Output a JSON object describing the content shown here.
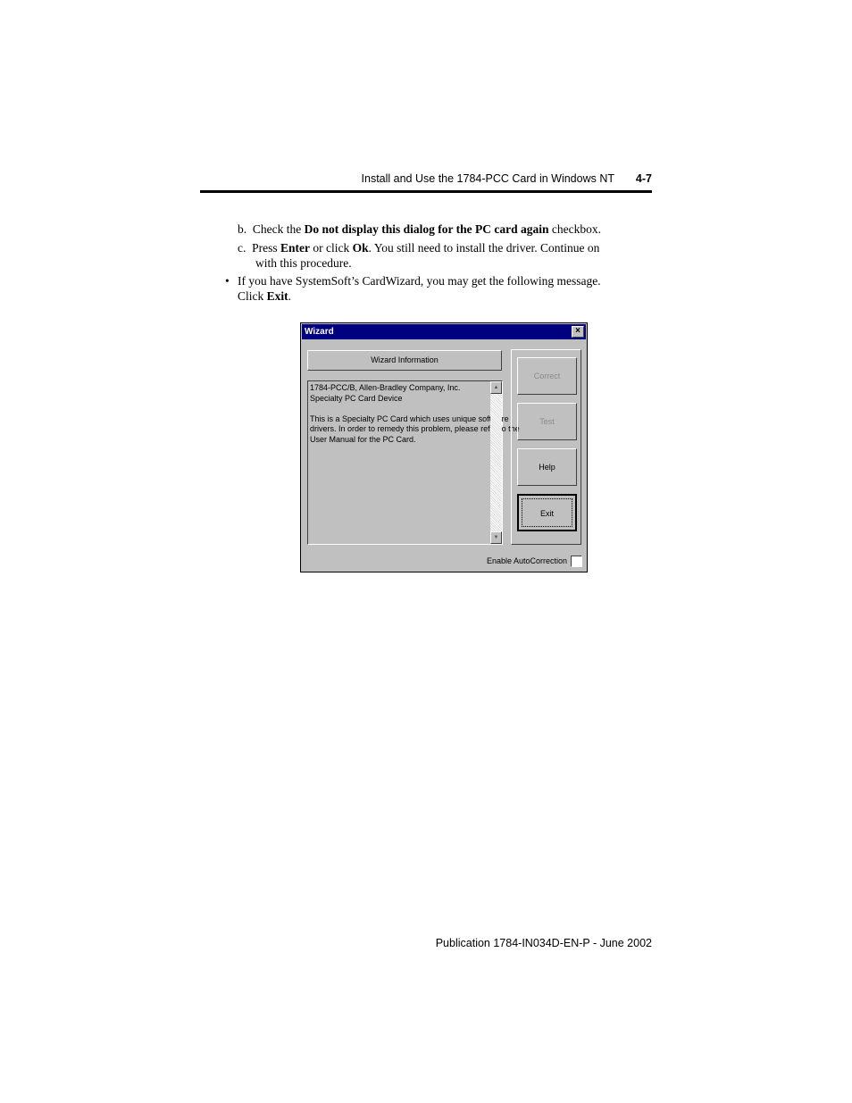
{
  "header": {
    "title": "Install and Use the 1784-PCC Card in Windows NT",
    "page_number": "4-7"
  },
  "steps": {
    "b": {
      "label": "b.",
      "before": "Check the ",
      "bold": "Do not display this dialog for the PC card again",
      "after": " checkbox."
    },
    "c": {
      "label": "c.",
      "t1": "Press ",
      "b1": "Enter",
      "t2": " or click ",
      "b2": "Ok",
      "t3": ". You still need to install the driver. Continue on",
      "line2": "with this procedure."
    }
  },
  "bullet": {
    "symbol": "•",
    "line1": "If you have SystemSoft’s CardWizard, you may get the following message.",
    "line2_before": "Click ",
    "line2_bold": "Exit",
    "line2_after": "."
  },
  "dialog": {
    "title": "Wizard",
    "close_glyph": "×",
    "info_header": "Wizard Information",
    "text_lines": [
      "1784-PCC/B, Allen-Bradley Company, Inc.",
      "Specialty PC Card Device",
      "",
      "This is a Specialty PC Card which uses unique software",
      "drivers.  In order to remedy this problem, please refer to the",
      "User Manual for the PC Card."
    ],
    "scroll_up": "▲",
    "scroll_down": "▼",
    "buttons": {
      "correct": "Correct",
      "test": "Test",
      "help": "Help",
      "exit": "Exit"
    },
    "autocorrection_label": "Enable AutoCorrection"
  },
  "footer": "Publication 1784-IN034D-EN-P - June 2002"
}
